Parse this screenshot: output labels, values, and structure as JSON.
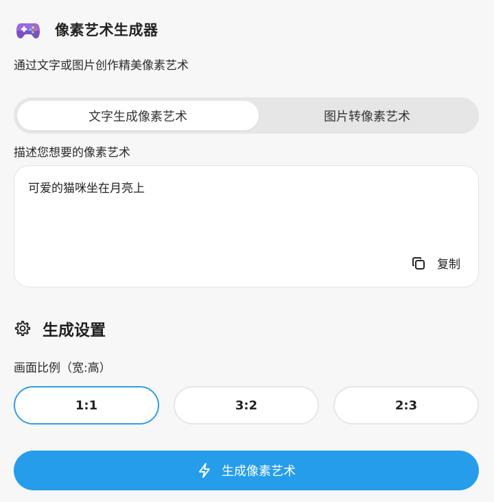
{
  "header": {
    "icon": "gamepad-icon",
    "title": "像素艺术生成器",
    "subtitle": "通过文字或图片创作精美像素艺术"
  },
  "tabs": [
    {
      "label": "文字生成像素艺术",
      "active": true
    },
    {
      "label": "图片转像素艺术",
      "active": false
    }
  ],
  "prompt": {
    "label": "描述您想要的像素艺术",
    "value": "可爱的猫咪坐在月亮上",
    "copy_icon": "copy-icon",
    "copy_label": "复制"
  },
  "settings": {
    "icon": "gear-icon",
    "title": "生成设置",
    "ratio_label": "画面比例（宽:高）",
    "ratios": [
      {
        "label": "1:1",
        "selected": true
      },
      {
        "label": "3:2",
        "selected": false
      },
      {
        "label": "2:3",
        "selected": false
      }
    ]
  },
  "generate": {
    "icon": "lightning-icon",
    "label": "生成像素艺术"
  },
  "colors": {
    "accent": "#259deb",
    "selected_border": "#2d9ee5",
    "background": "#f7f7f7"
  }
}
